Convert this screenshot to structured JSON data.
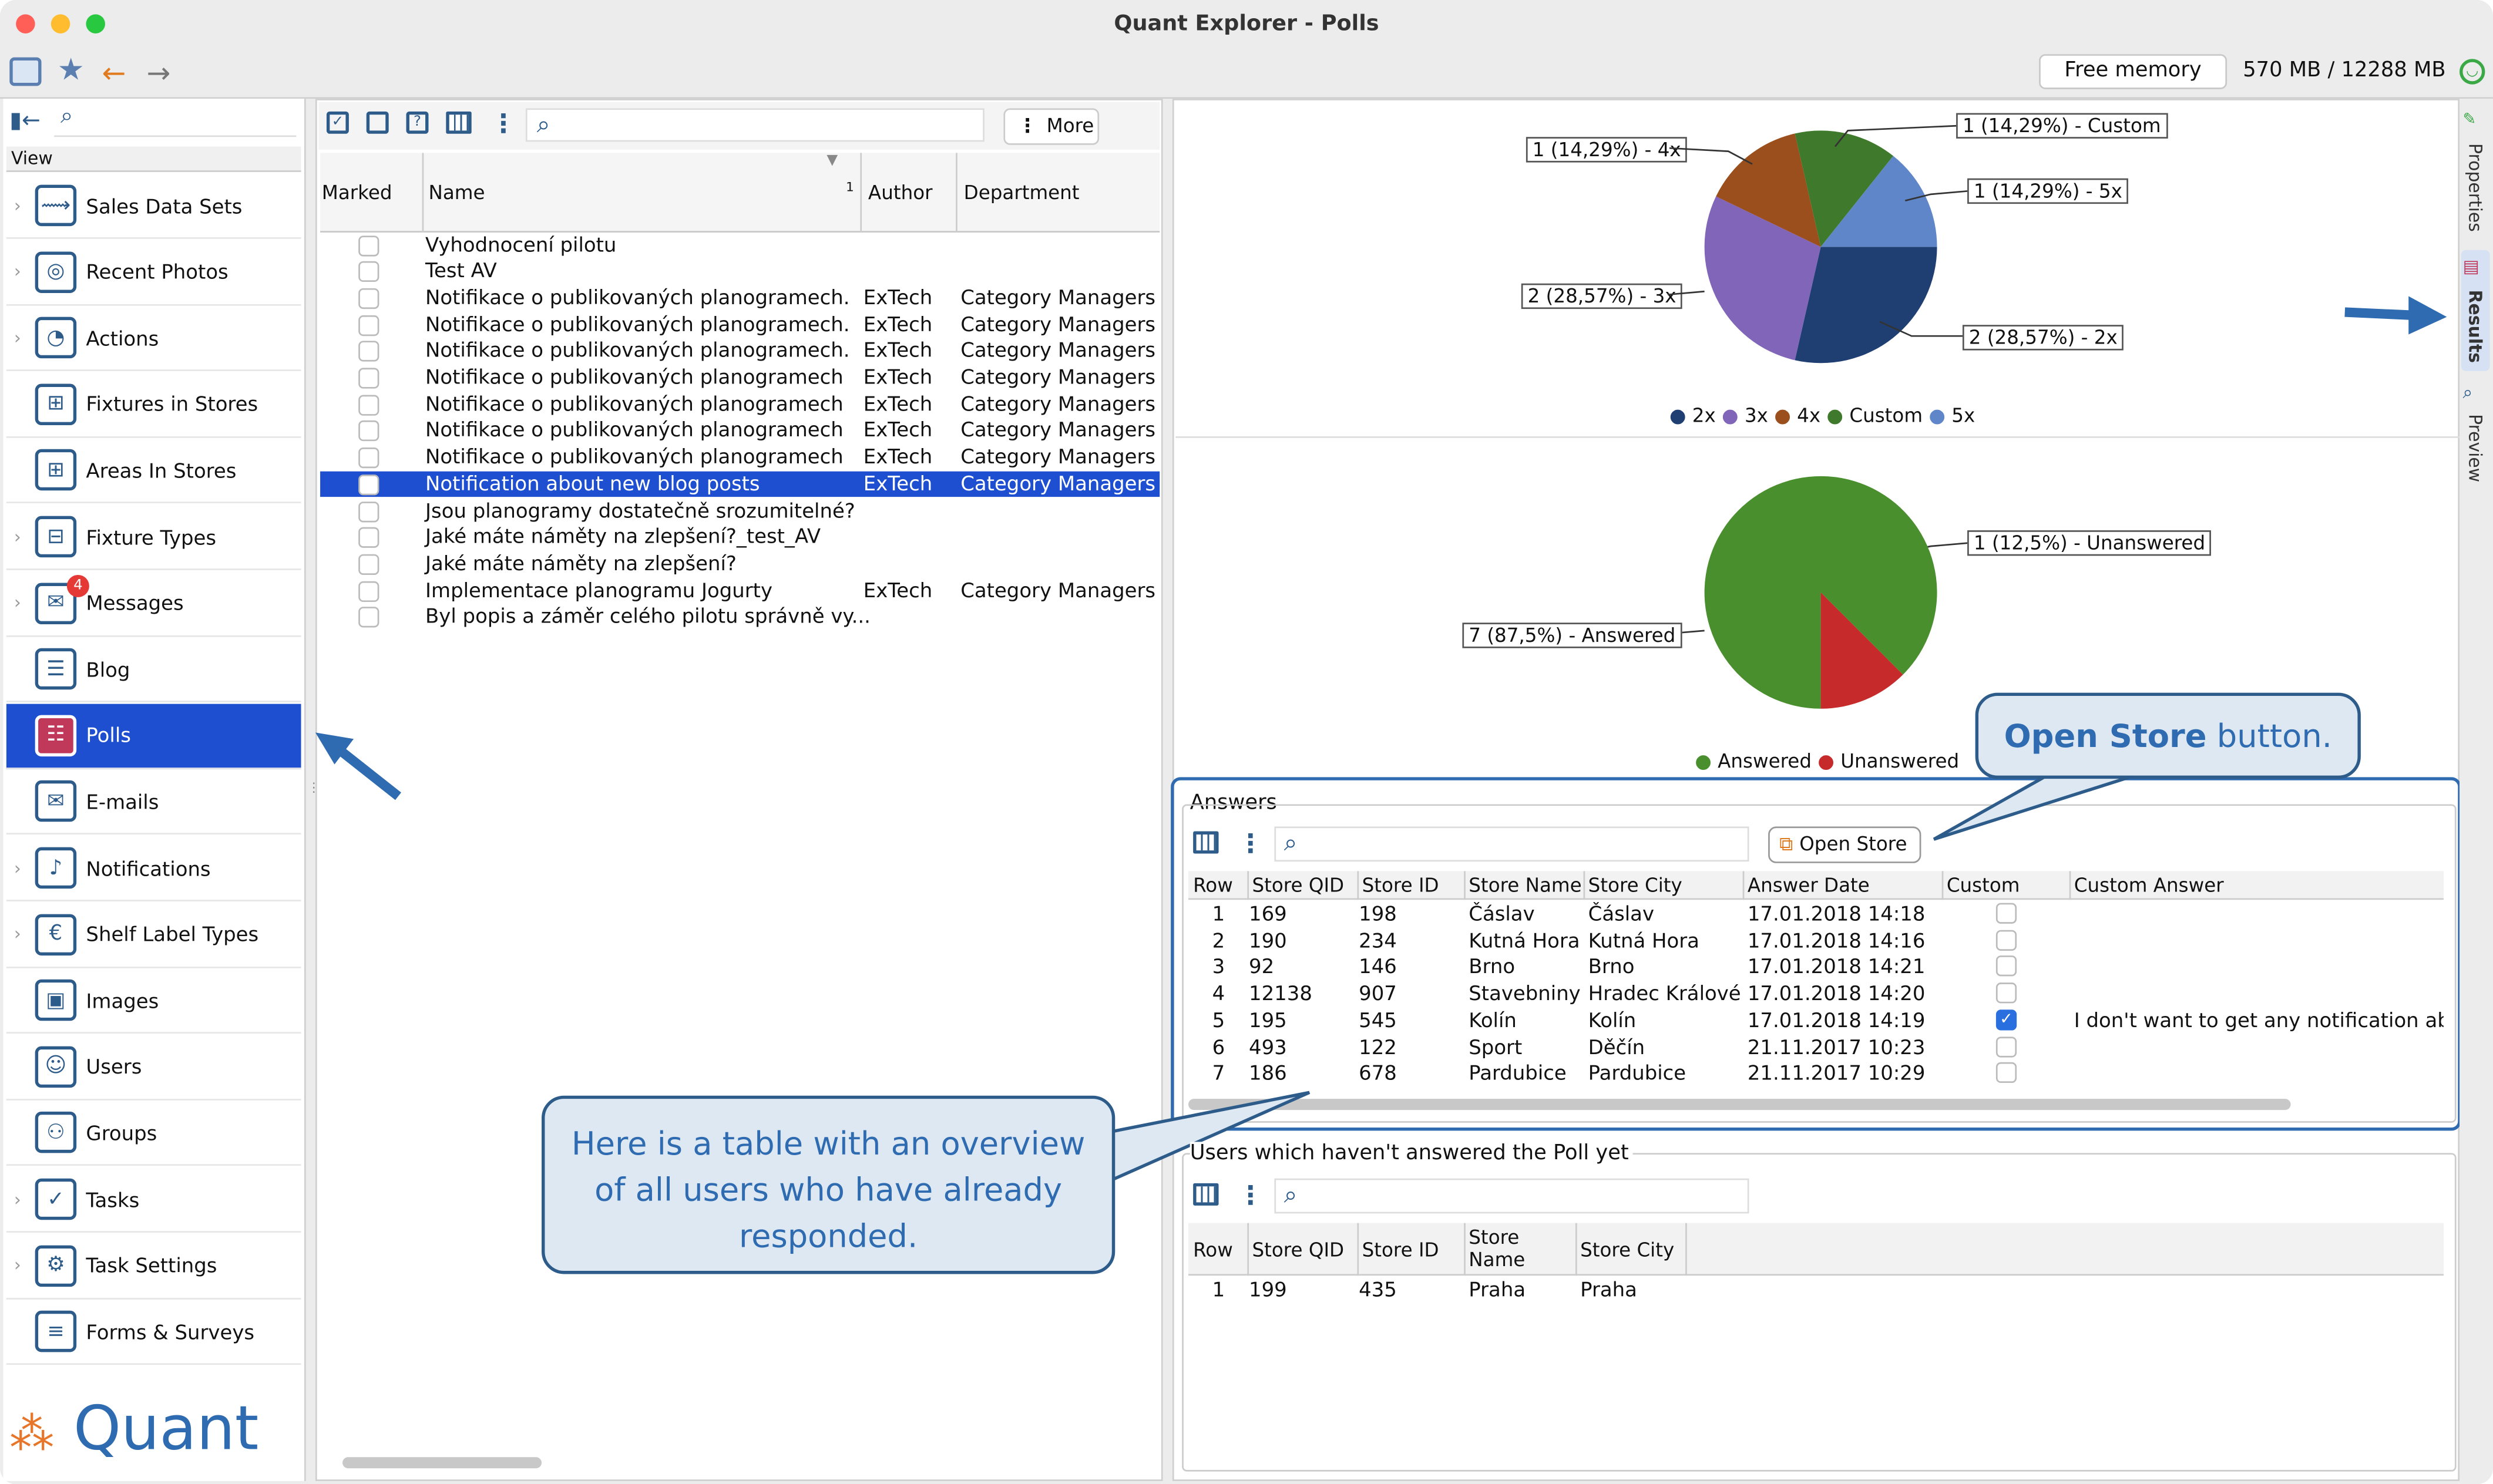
{
  "window": {
    "title": "Quant Explorer - Polls"
  },
  "toolbar": {
    "memory_label": "Free memory",
    "memory_value": "570 MB / 12288 MB"
  },
  "sidebar": {
    "view_header": "View",
    "items": [
      {
        "label": "Sales Data Sets",
        "icon": "sales-data-icon"
      },
      {
        "label": "Recent Photos",
        "icon": "camera-icon"
      },
      {
        "label": "Actions",
        "icon": "actions-icon"
      },
      {
        "label": "Fixtures in Stores",
        "icon": "grid-icon"
      },
      {
        "label": "Areas In Stores",
        "icon": "grid-icon"
      },
      {
        "label": "Fixture Types",
        "icon": "fixture-icon"
      },
      {
        "label": "Messages",
        "icon": "messages-icon",
        "badge": "4"
      },
      {
        "label": "Blog",
        "icon": "blog-icon"
      },
      {
        "label": "Polls",
        "icon": "polls-icon"
      },
      {
        "label": "E-mails",
        "icon": "mail-icon"
      },
      {
        "label": "Notifications",
        "icon": "bell-icon"
      },
      {
        "label": "Shelf Label Types",
        "icon": "label-icon"
      },
      {
        "label": "Images",
        "icon": "image-icon"
      },
      {
        "label": "Users",
        "icon": "user-icon"
      },
      {
        "label": "Groups",
        "icon": "group-icon"
      },
      {
        "label": "Tasks",
        "icon": "task-icon"
      },
      {
        "label": "Task Settings",
        "icon": "task-settings-icon"
      },
      {
        "label": "Forms & Surveys",
        "icon": "forms-icon"
      }
    ],
    "logo": "Quant"
  },
  "polls": {
    "more_label": "More",
    "columns": [
      "Marked",
      "Name",
      "Author",
      "Department"
    ],
    "rows": [
      {
        "name": "Vyhodnocení pilotu",
        "author": "",
        "dept": ""
      },
      {
        "name": "Test AV",
        "author": "",
        "dept": ""
      },
      {
        "name": "Notifikace o publikovaných planogramech.",
        "author": "ExTech",
        "dept": "Category Managers"
      },
      {
        "name": "Notifikace o publikovaných planogramech.",
        "author": "ExTech",
        "dept": "Category Managers"
      },
      {
        "name": "Notifikace o publikovaných planogramech.",
        "author": "ExTech",
        "dept": "Category Managers"
      },
      {
        "name": "Notifikace o publikovaných planogramech",
        "author": "ExTech",
        "dept": "Category Managers"
      },
      {
        "name": "Notifikace o publikovaných planogramech",
        "author": "ExTech",
        "dept": "Category Managers"
      },
      {
        "name": "Notifikace o publikovaných planogramech",
        "author": "ExTech",
        "dept": "Category Managers"
      },
      {
        "name": "Notifikace o publikovaných planogramech",
        "author": "ExTech",
        "dept": "Category Managers"
      },
      {
        "name": "Notification about new blog posts",
        "author": "ExTech",
        "dept": "Category Managers"
      },
      {
        "name": "Jsou planogramy dostatečně srozumitelné?",
        "author": "",
        "dept": ""
      },
      {
        "name": "Jaké máte náměty na zlepšení?_test_AV",
        "author": "",
        "dept": ""
      },
      {
        "name": "Jaké máte náměty na zlepšení?",
        "author": "",
        "dept": ""
      },
      {
        "name": "Implementace planogramu Jogurty",
        "author": "ExTech",
        "dept": "Category Managers"
      },
      {
        "name": "Byl popis a záměr celého pilotu správně vy...",
        "author": "",
        "dept": ""
      }
    ]
  },
  "chart_data": [
    {
      "type": "pie",
      "categories": [
        "2x",
        "3x",
        "4x",
        "Custom",
        "5x"
      ],
      "values": [
        2,
        2,
        1,
        1,
        1
      ],
      "slice_labels": [
        "2 (28,57%) - 2x",
        "2 (28,57%) - 3x",
        "1 (14,29%) - 4x",
        "1 (14,29%) - Custom",
        "1 (14,29%) - 5x"
      ],
      "colors": [
        "#1f3f73",
        "#8065b8",
        "#9a4f1c",
        "#3f7a2c",
        "#5f86c8"
      ],
      "legend": "bottom"
    },
    {
      "type": "pie",
      "categories": [
        "Answered",
        "Unanswered"
      ],
      "values": [
        7,
        1
      ],
      "slice_labels": [
        "7 (87,5%) - Answered",
        "1 (12,5%) - Unanswered"
      ],
      "colors": [
        "#4a8f2e",
        "#c62a2a"
      ],
      "legend": "bottom"
    }
  ],
  "answers": {
    "title": "Answers",
    "open_store_label": "Open Store",
    "columns": [
      "Row",
      "Store QID",
      "Store ID",
      "Store Name",
      "Store City",
      "Answer Date",
      "Custom",
      "Custom Answer"
    ],
    "rows": [
      {
        "row": "1",
        "qid": "169",
        "sid": "198",
        "name": "Čáslav",
        "city": "Čáslav",
        "date": "17.01.2018 14:18",
        "custom": false,
        "answer": ""
      },
      {
        "row": "2",
        "qid": "190",
        "sid": "234",
        "name": "Kutná Hora",
        "city": "Kutná Hora",
        "date": "17.01.2018 14:16",
        "custom": false,
        "answer": ""
      },
      {
        "row": "3",
        "qid": "92",
        "sid": "146",
        "name": "Brno",
        "city": "Brno",
        "date": "17.01.2018 14:21",
        "custom": false,
        "answer": ""
      },
      {
        "row": "4",
        "qid": "12138",
        "sid": "907",
        "name": "Stavebniny",
        "city": "Hradec Králové",
        "date": "17.01.2018 14:20",
        "custom": false,
        "answer": ""
      },
      {
        "row": "5",
        "qid": "195",
        "sid": "545",
        "name": "Kolín",
        "city": "Kolín",
        "date": "17.01.2018 14:19",
        "custom": true,
        "answer": "I don't want to get any notification abou"
      },
      {
        "row": "6",
        "qid": "493",
        "sid": "122",
        "name": "Sport",
        "city": "Děčín",
        "date": "21.11.2017 10:23",
        "custom": false,
        "answer": ""
      },
      {
        "row": "7",
        "qid": "186",
        "sid": "678",
        "name": "Pardubice",
        "city": "Pardubice",
        "date": "21.11.2017 10:29",
        "custom": false,
        "answer": ""
      }
    ]
  },
  "unanswered": {
    "title": "Users which haven't answered the Poll yet",
    "columns": [
      "Row",
      "Store QID",
      "Store ID",
      "Store Name",
      "Store City"
    ],
    "rows": [
      {
        "row": "1",
        "qid": "199",
        "sid": "435",
        "name": "Praha",
        "city": "Praha"
      }
    ]
  },
  "side_tabs": [
    "Properties",
    "Results",
    "Preview"
  ],
  "callouts": {
    "open_store_bold": "Open Store",
    "open_store_rest": " button.",
    "table_note": "Here is a table with an overview of all users who have already responded."
  },
  "colors": {
    "accent": "#1d4fd0",
    "callout_fill": "#dde8f3",
    "callout_text": "#2e6bb0"
  }
}
